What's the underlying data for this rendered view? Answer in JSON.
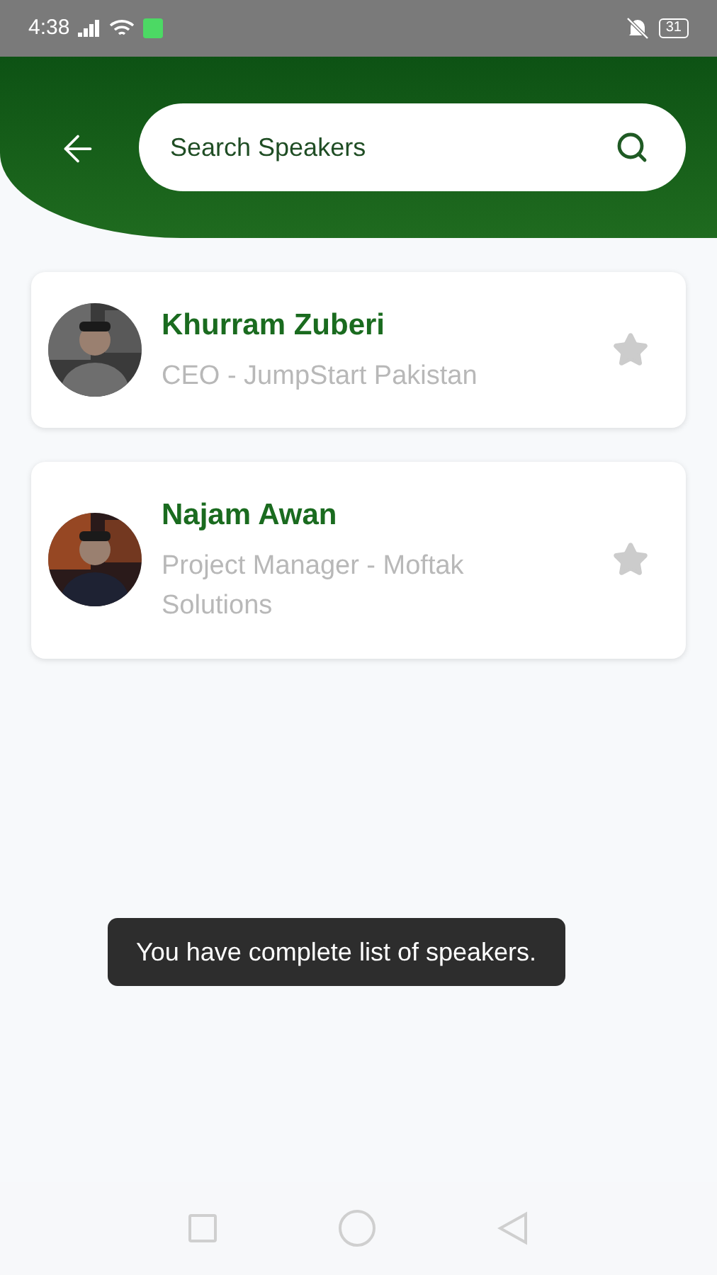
{
  "status_bar": {
    "time": "4:38",
    "battery": "31"
  },
  "search": {
    "placeholder": "Search Speakers"
  },
  "speakers": [
    {
      "name": "Khurram Zuberi",
      "role": "CEO - JumpStart Pakistan",
      "favorite": false
    },
    {
      "name": "Najam Awan",
      "role": "Project Manager - Moftak Solutions",
      "favorite": false
    }
  ],
  "toast": "You have complete list of speakers."
}
